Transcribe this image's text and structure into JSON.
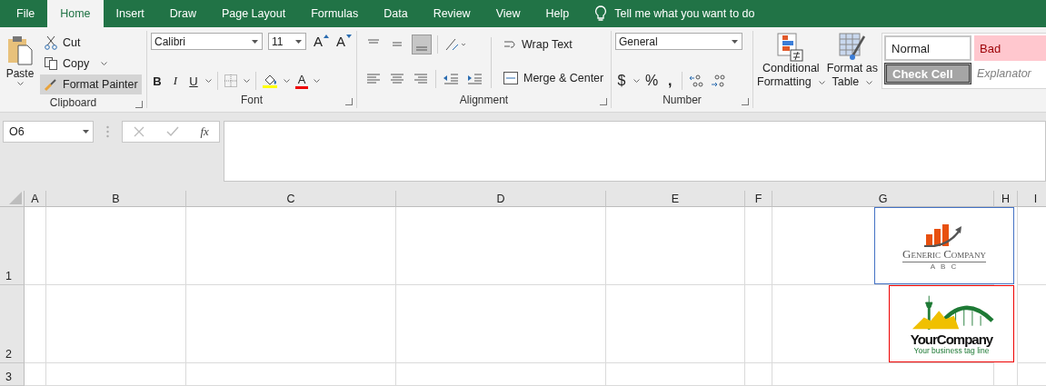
{
  "menu": {
    "tabs": [
      {
        "label": "File",
        "selected": false
      },
      {
        "label": "Home",
        "selected": true
      },
      {
        "label": "Insert",
        "selected": false
      },
      {
        "label": "Draw",
        "selected": false
      },
      {
        "label": "Page Layout",
        "selected": false
      },
      {
        "label": "Formulas",
        "selected": false
      },
      {
        "label": "Data",
        "selected": false
      },
      {
        "label": "Review",
        "selected": false
      },
      {
        "label": "View",
        "selected": false
      },
      {
        "label": "Help",
        "selected": false
      }
    ],
    "tell_me": "Tell me what you want to do"
  },
  "ribbon": {
    "clipboard": {
      "paste": "Paste",
      "cut": "Cut",
      "copy": "Copy",
      "format_painter": {
        "label": "Format Painter",
        "selected": true
      },
      "label": "Clipboard"
    },
    "font": {
      "font_name": "Calibri",
      "font_size": "11",
      "grow": "A",
      "shrink": "A",
      "bold": "B",
      "italic": "I",
      "underline": "U",
      "font_color": "A",
      "label": "Font"
    },
    "alignment": {
      "wrap_text": "Wrap Text",
      "merge_center": "Merge & Center",
      "label": "Alignment"
    },
    "number": {
      "format": "General",
      "currency": "$",
      "percent": "%",
      "comma": ",",
      "label": "Number"
    },
    "styles": {
      "conditional_formatting": [
        "Conditional",
        "Formatting"
      ],
      "format_as_table": [
        "Format as",
        "Table"
      ],
      "cells": [
        {
          "label": "Normal",
          "kind": "normal"
        },
        {
          "label": "Bad",
          "kind": "bad"
        },
        {
          "label": "Check Cell",
          "kind": "check"
        },
        {
          "label": "Explanator",
          "kind": "explanatory"
        }
      ]
    }
  },
  "formula_bar": {
    "name_box": "O6",
    "function_label": "fx"
  },
  "sheet": {
    "columns": [
      "A",
      "B",
      "C",
      "D",
      "E",
      "F",
      "G",
      "H",
      "I"
    ],
    "rows": [
      "1",
      "2",
      "3"
    ],
    "logos": [
      {
        "kind": "generic",
        "name": "Generic Company",
        "tagline": "A B C"
      },
      {
        "kind": "city",
        "name": "YourCompany",
        "tagline": "Your business tag line"
      }
    ]
  }
}
